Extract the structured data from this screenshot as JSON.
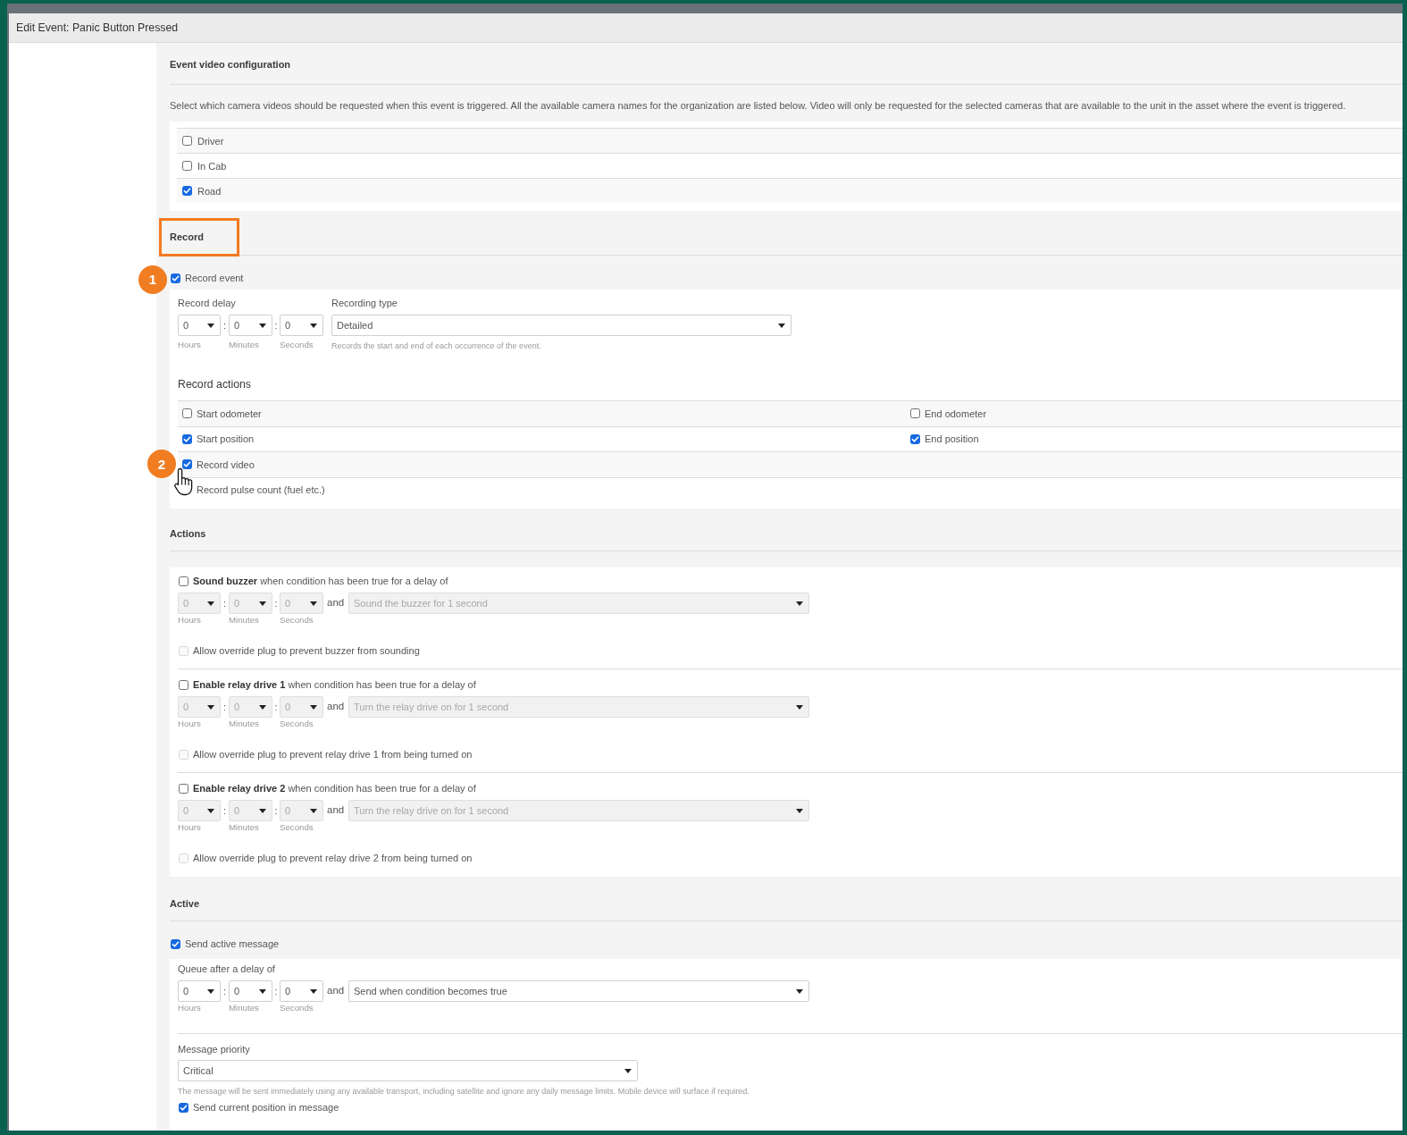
{
  "window": {
    "title": "Edit Event: Panic Button Pressed"
  },
  "event_video": {
    "heading": "Event video configuration",
    "description": "Select which camera videos should be requested when this event is triggered. All the available camera names for the organization are listed below. Video will only be requested for the selected cameras that are available to the unit in the asset where the event is triggered.",
    "cameras": [
      {
        "label": "Driver",
        "checked": false
      },
      {
        "label": "In Cab",
        "checked": false
      },
      {
        "label": "Road",
        "checked": true
      }
    ]
  },
  "record": {
    "heading": "Record",
    "highlighted": true,
    "record_event": {
      "label": "Record event",
      "checked": true,
      "callout": "1"
    },
    "record_delay": {
      "label": "Record delay",
      "disabled": false,
      "hours": "0",
      "minutes": "0",
      "seconds": "0",
      "separators": [
        ":",
        ":"
      ],
      "unit_labels": [
        "Hours",
        "Minutes",
        "Seconds"
      ]
    },
    "recording_type": {
      "label": "Recording type",
      "value": "Detailed",
      "help": "Records the start and end of each occurrence of the event."
    },
    "actions_heading": "Record actions",
    "actions": [
      {
        "cursor": false,
        "cells": [
          {
            "label": "Start odometer",
            "checked": false
          },
          {
            "label": "End odometer",
            "checked": false
          }
        ]
      },
      {
        "cursor": false,
        "cells": [
          {
            "label": "Start position",
            "checked": true
          },
          {
            "label": "End position",
            "checked": true
          }
        ]
      },
      {
        "cursor": true,
        "callout": "2",
        "cells": [
          {
            "label": "Record video",
            "checked": true
          }
        ]
      },
      {
        "cursor": false,
        "cells": [
          {
            "label": "Record pulse count (fuel etc.)"
          }
        ]
      }
    ]
  },
  "actions": {
    "heading": "Actions",
    "items": [
      {
        "checked": false,
        "label": "**Sound buzzer** when condition has been true for a delay of",
        "disabled": true,
        "hours": "0",
        "minutes": "0",
        "seconds": "0",
        "separators": [
          ":",
          ":"
        ],
        "conjunction": "and",
        "duration": "Sound the buzzer for 1 second",
        "unit_labels": [
          "Hours",
          "Minutes",
          "Seconds"
        ],
        "override": {
          "label": "Allow override plug to prevent buzzer from sounding",
          "checked": false,
          "disabled": true
        }
      },
      {
        "checked": false,
        "label": "**Enable relay drive 1** when condition has been true for a delay of",
        "disabled": true,
        "hours": "0",
        "minutes": "0",
        "seconds": "0",
        "separators": [
          ":",
          ":"
        ],
        "conjunction": "and",
        "duration": "Turn the relay drive on for 1 second",
        "unit_labels": [
          "Hours",
          "Minutes",
          "Seconds"
        ],
        "override": {
          "label": "Allow override plug to prevent relay drive 1 from being turned on",
          "checked": false,
          "disabled": true
        }
      },
      {
        "checked": false,
        "label": "**Enable relay drive 2** when condition has been true for a delay of",
        "disabled": true,
        "hours": "0",
        "minutes": "0",
        "seconds": "0",
        "separators": [
          ":",
          ":"
        ],
        "conjunction": "and",
        "duration": "Turn the relay drive on for 1 second",
        "unit_labels": [
          "Hours",
          "Minutes",
          "Seconds"
        ],
        "override": {
          "label": "Allow override plug to prevent relay drive 2 from being turned on",
          "checked": false,
          "disabled": true
        }
      }
    ]
  },
  "active": {
    "heading": "Active",
    "send_active_message": {
      "label": "Send active message",
      "checked": true
    },
    "queue": {
      "label": "Queue after a delay of",
      "disabled": false,
      "hours": "0",
      "minutes": "0",
      "seconds": "0",
      "separators": [
        ":",
        ":"
      ],
      "conjunction": "and",
      "condition": "Send when condition becomes true",
      "unit_labels": [
        "Hours",
        "Minutes",
        "Seconds"
      ]
    },
    "priority": {
      "label": "Message priority",
      "value": "Critical",
      "help": "The message will be sent immediately using any available transport, including satellite and ignore any daily message limits. Mobile device will surface if required."
    },
    "send_position": {
      "label": "Send current position in message",
      "checked": true
    }
  }
}
